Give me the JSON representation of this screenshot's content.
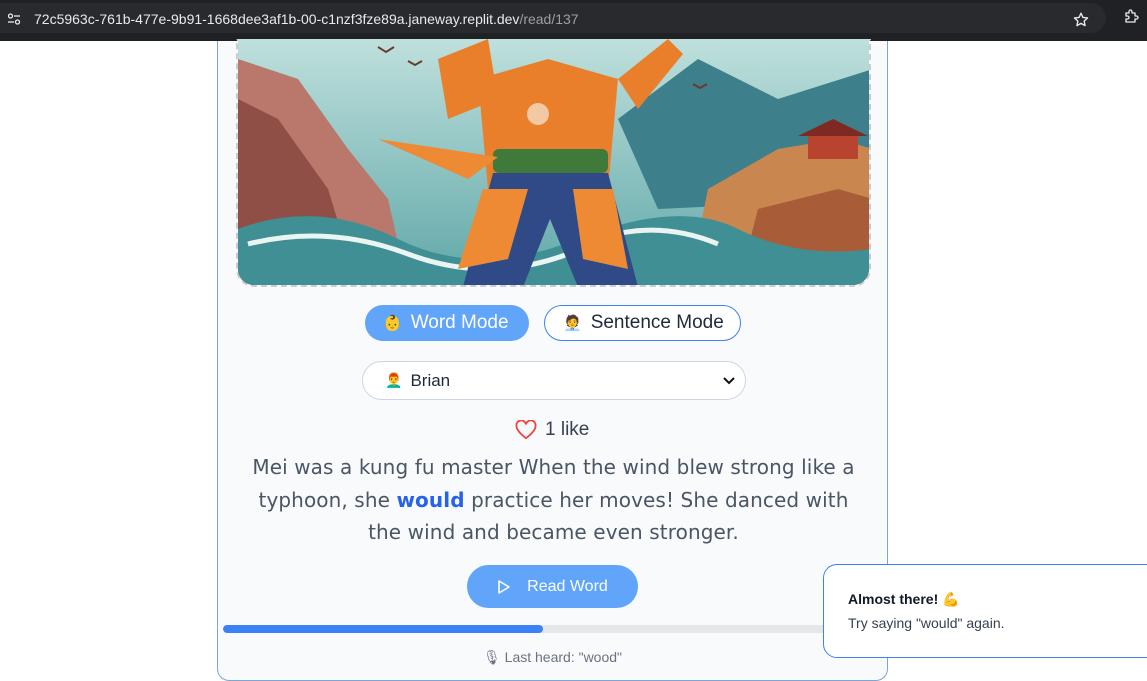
{
  "browser": {
    "url_host": "72c5963c-761b-477e-9b91-1668dee3af1b-00-c1nzf3fze89a.janeway.replit.dev",
    "url_path": "/read/137"
  },
  "illustration": {
    "alt_icon": "kung-fu-master-illustration"
  },
  "modes": {
    "word_emoji": "👶",
    "word_label": "Word Mode",
    "sentence_emoji": "🧑‍💼",
    "sentence_label": "Sentence Mode",
    "active": "word"
  },
  "voice": {
    "emoji": "👨‍🦰",
    "selected": "Brian"
  },
  "likes": {
    "label": "1 like"
  },
  "story": {
    "before": "Mei was a kung fu master When the wind blew strong like a typhoon, she ",
    "highlight": "would",
    "after": " practice her moves! She danced with the wind and became even stronger."
  },
  "read_button": {
    "label": "Read Word"
  },
  "progress": {
    "fraction": 0.5
  },
  "last_heard": {
    "text": "🎙 Last heard: \"wood\""
  },
  "toast": {
    "title": "Almost there! 💪",
    "message": "Try saying \"would\" again."
  },
  "colors": {
    "accent": "#60a5fa",
    "highlight": "#2563eb",
    "heart": "#ef4444"
  }
}
